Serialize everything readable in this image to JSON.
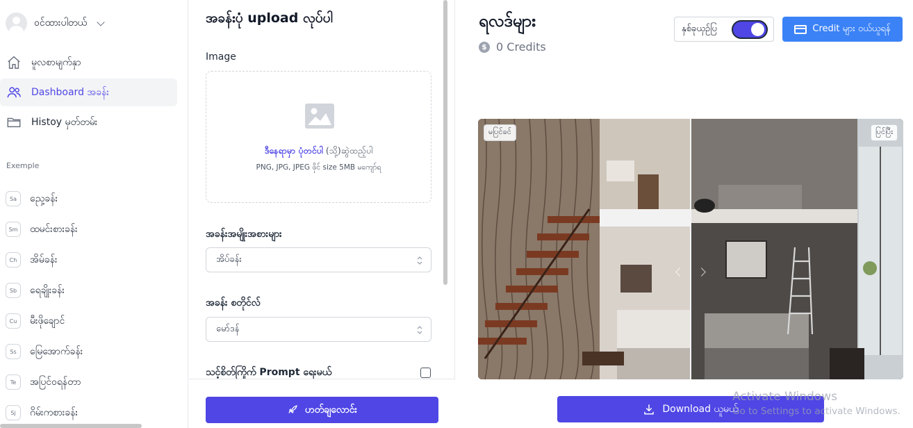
{
  "sidebar": {
    "user_name": "ဝင်ထားပါတယ်",
    "nav": [
      {
        "label": "မူလစာမျက်နှာ",
        "icon": "home-icon"
      },
      {
        "label": "Dashboard အခန်း",
        "icon": "users-icon",
        "active": true
      },
      {
        "label": "Histoy မှတ်တမ်း",
        "icon": "folder-icon"
      }
    ],
    "section_label": "Exemple",
    "examples": [
      {
        "badge": "Sa",
        "label": "ညှေ့ခန်း"
      },
      {
        "badge": "Sm",
        "label": "ထမင်းစားခန်း"
      },
      {
        "badge": "Ch",
        "label": "အိမ်ခန်း"
      },
      {
        "badge": "Sb",
        "label": "ရေချိုးခန်း"
      },
      {
        "badge": "Cu",
        "label": "မီးဖိုချောင်"
      },
      {
        "badge": "Ss",
        "label": "မြေအောက်ခန်း"
      },
      {
        "badge": "Te",
        "label": "အပြင်ဝရန်တာ"
      },
      {
        "badge": "Sj",
        "label": "ဂိမ်းကစားခန်း"
      }
    ]
  },
  "upload": {
    "title": "အခန်းပုံ upload လုပ်ပါ",
    "image_label": "Image",
    "drop_link": "ဒီနေရာမှာ ပုံတင်ပါ",
    "drop_rest": " (သို့)ဆွဲထည့်ပါ",
    "drop_hint": "PNG, JPG, JPEG ဖိုင် size 5MB မကျော်ရ",
    "room_type_label": "အခန်းအမျိုးအစားများ",
    "room_type_value": "အိပ်ခန်း",
    "room_style_label": "အခန်း စတိုင်လ်",
    "room_style_value": "မော်ဒန်",
    "custom_prompt_label": "သင့်စိတ်ကြိုက် Prompt ရေးမယ်",
    "submit_label": "ဟတ်ချလောင်း"
  },
  "result": {
    "title": "ရလဒ်များ",
    "credits_text": "0 Credits",
    "credits_symbol": "$",
    "toggle_label": "နှစ်ခုယှဉ်ပြ",
    "toggle_on": true,
    "buy_label": "Credit များ ဝယ်ယူရန်",
    "before_tag": "မပြင်ခင်",
    "after_tag": "ပြင်ပြီး",
    "download_label": "Download ယူမယ်"
  },
  "watermark": {
    "line1": "Activate Windows",
    "line2": "Go to Settings to activate Windows."
  },
  "colors": {
    "accent": "#4f46e5",
    "buy_button": "#3b82f6"
  }
}
